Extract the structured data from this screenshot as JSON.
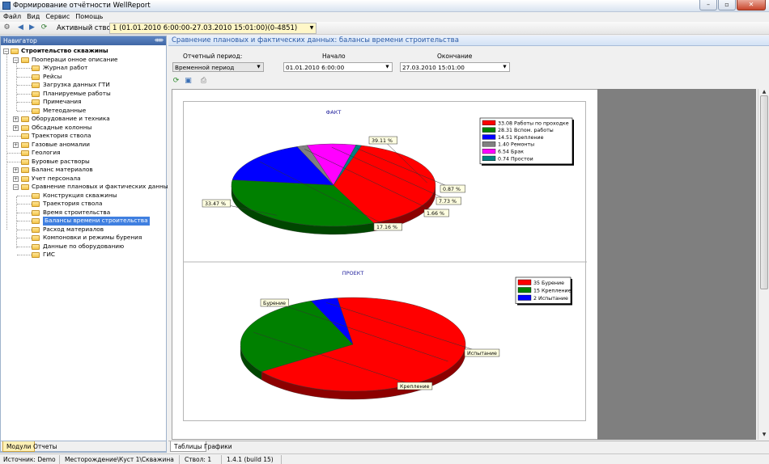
{
  "window": {
    "title": "Формирование отчётности WellReport"
  },
  "menu": [
    "Файл",
    "Вид",
    "Сервис",
    "Помощь"
  ],
  "toolbar": {
    "active_well_label": "Активный ствол:",
    "active_well_value": "1 (01.01.2010 6:00:00-27.03.2010 15:01:00)(0-4851)"
  },
  "navigator": {
    "title": "Навигатор",
    "root": "Строительство скважины",
    "items": [
      {
        "label": "Поопераци онное описание"
      },
      {
        "label": "Журнал работ"
      },
      {
        "label": "Рейсы"
      },
      {
        "label": "Загрузка данных ГТИ"
      },
      {
        "label": "Планируемые работы"
      },
      {
        "label": "Примечания"
      },
      {
        "label": "Метеоданные"
      },
      {
        "label": "Оборудование и техника"
      },
      {
        "label": "Обсадные колонны"
      },
      {
        "label": "Траектория ствола"
      },
      {
        "label": "Газовые аномалии"
      },
      {
        "label": "Геология"
      },
      {
        "label": "Буровые растворы"
      },
      {
        "label": "Баланс материалов"
      },
      {
        "label": "Учет персонала"
      },
      {
        "label": "Сравнение плановых и фактических данных"
      },
      {
        "label": "Конструкция скважины"
      },
      {
        "label": "Траектория ствола"
      },
      {
        "label": "Время строительства"
      },
      {
        "label": "Балансы времени строительства"
      },
      {
        "label": "Расход материалов"
      },
      {
        "label": "Компоновки и режимы бурения"
      },
      {
        "label": "Данные по оборудованию"
      },
      {
        "label": "ГИС"
      }
    ],
    "tabs": [
      "Модули",
      "Отчеты"
    ]
  },
  "main": {
    "title": "Сравнение плановых и фактических данных: балансы времени строительства",
    "period_label": "Отчетный период:",
    "period_value": "Временной период",
    "start_label": "Начало",
    "start_value": "01.01.2010 6:00:00",
    "end_label": "Окончание",
    "end_value": "27.03.2010 15:01:00",
    "bottom_tabs": [
      "Таблицы",
      "Графики"
    ]
  },
  "status": {
    "source": "Источник: Demo",
    "field": "Месторождение\\Куст 1\\Скважина 11",
    "well": "Ствол: 1",
    "version": "1.4.1 (build 15) Port"
  },
  "chart_data": [
    {
      "type": "pie",
      "title": "ФАКТ",
      "slices": [
        {
          "label": "Работы по проходке",
          "value": 33.08,
          "pct": "39.11 %",
          "color": "#ff0000"
        },
        {
          "label": "Вспом. работы",
          "value": 28.31,
          "pct": "33.47 %",
          "color": "#008000"
        },
        {
          "label": "Крепление",
          "value": 14.51,
          "pct": "17.16 %",
          "color": "#0000ff"
        },
        {
          "label": "Ремонты",
          "value": 1.4,
          "pct": "1.66 %",
          "color": "#808080"
        },
        {
          "label": "Брак",
          "value": 6.54,
          "pct": "7.73 %",
          "color": "#ff00ff"
        },
        {
          "label": "Простои",
          "value": 0.74,
          "pct": "0.87 %",
          "color": "#008080"
        }
      ],
      "legend_position": "top-right"
    },
    {
      "type": "pie",
      "title": "ПРОЕКТ",
      "slices": [
        {
          "label": "Бурение",
          "value": 35,
          "pct": "Бурение",
          "color": "#ff0000"
        },
        {
          "label": "Крепление",
          "value": 15,
          "pct": "Крепление",
          "color": "#008000"
        },
        {
          "label": "Испытание",
          "value": 2,
          "pct": "Испытание",
          "color": "#0000ff"
        }
      ],
      "legend_position": "top-right"
    }
  ]
}
